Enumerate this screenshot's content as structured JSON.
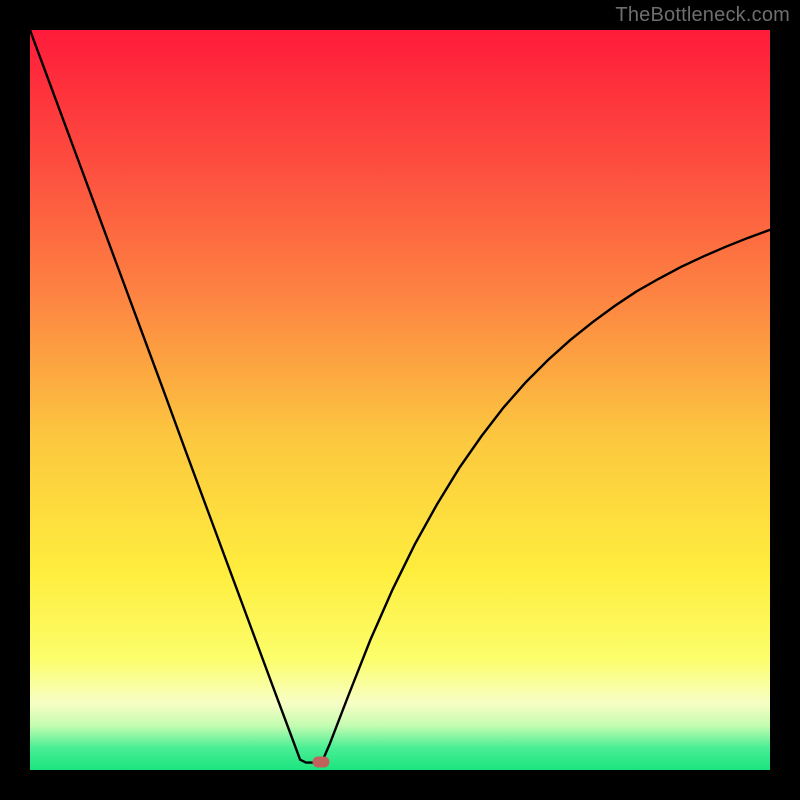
{
  "watermark": {
    "text": "TheBottleneck.com"
  },
  "chart_data": {
    "type": "line",
    "title": "",
    "xlabel": "",
    "ylabel": "",
    "x_range": [
      0,
      1
    ],
    "y_range": [
      0,
      1
    ],
    "background": {
      "gradient_stops": [
        {
          "offset": 0.0,
          "color": "#fe1b3a"
        },
        {
          "offset": 0.18,
          "color": "#fd4d3f"
        },
        {
          "offset": 0.36,
          "color": "#fd8442"
        },
        {
          "offset": 0.55,
          "color": "#fcc73f"
        },
        {
          "offset": 0.73,
          "color": "#feed3d"
        },
        {
          "offset": 0.85,
          "color": "#fcfe6b"
        },
        {
          "offset": 0.91,
          "color": "#f7fec5"
        },
        {
          "offset": 0.94,
          "color": "#c4fcb1"
        },
        {
          "offset": 0.97,
          "color": "#4aee94"
        },
        {
          "offset": 1.0,
          "color": "#1ae47e"
        }
      ]
    },
    "series": [
      {
        "name": "bottleneck-curve",
        "stroke": "#000000",
        "stroke_width": 2.4,
        "points": [
          {
            "x": 0.0,
            "y": 1.0
          },
          {
            "x": 0.03,
            "y": 0.919
          },
          {
            "x": 0.06,
            "y": 0.838
          },
          {
            "x": 0.09,
            "y": 0.757
          },
          {
            "x": 0.12,
            "y": 0.676
          },
          {
            "x": 0.15,
            "y": 0.595
          },
          {
            "x": 0.18,
            "y": 0.514
          },
          {
            "x": 0.21,
            "y": 0.432
          },
          {
            "x": 0.24,
            "y": 0.351
          },
          {
            "x": 0.27,
            "y": 0.27
          },
          {
            "x": 0.3,
            "y": 0.189
          },
          {
            "x": 0.33,
            "y": 0.108
          },
          {
            "x": 0.355,
            "y": 0.041
          },
          {
            "x": 0.365,
            "y": 0.014
          },
          {
            "x": 0.373,
            "y": 0.01
          },
          {
            "x": 0.388,
            "y": 0.01
          },
          {
            "x": 0.395,
            "y": 0.012
          },
          {
            "x": 0.405,
            "y": 0.035
          },
          {
            "x": 0.43,
            "y": 0.1
          },
          {
            "x": 0.46,
            "y": 0.176
          },
          {
            "x": 0.49,
            "y": 0.244
          },
          {
            "x": 0.52,
            "y": 0.305
          },
          {
            "x": 0.55,
            "y": 0.359
          },
          {
            "x": 0.58,
            "y": 0.408
          },
          {
            "x": 0.61,
            "y": 0.451
          },
          {
            "x": 0.64,
            "y": 0.49
          },
          {
            "x": 0.67,
            "y": 0.524
          },
          {
            "x": 0.7,
            "y": 0.554
          },
          {
            "x": 0.73,
            "y": 0.581
          },
          {
            "x": 0.76,
            "y": 0.605
          },
          {
            "x": 0.79,
            "y": 0.627
          },
          {
            "x": 0.82,
            "y": 0.647
          },
          {
            "x": 0.85,
            "y": 0.664
          },
          {
            "x": 0.88,
            "y": 0.68
          },
          {
            "x": 0.91,
            "y": 0.694
          },
          {
            "x": 0.94,
            "y": 0.707
          },
          {
            "x": 0.97,
            "y": 0.719
          },
          {
            "x": 1.0,
            "y": 0.73
          }
        ]
      }
    ],
    "marker": {
      "x": 0.393,
      "y": 0.011,
      "color": "#c0625b"
    }
  }
}
